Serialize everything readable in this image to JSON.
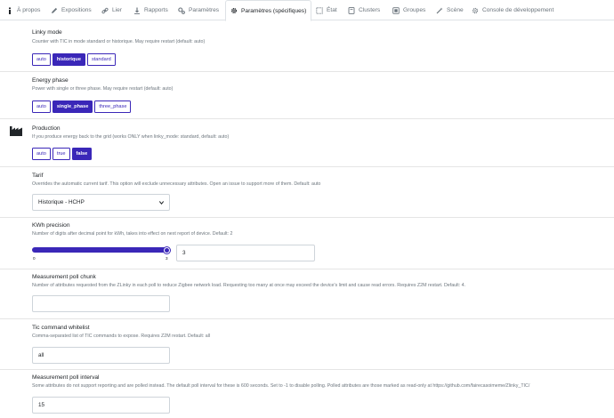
{
  "tabs": [
    {
      "label": "À propos",
      "icon": "info-icon",
      "active": false
    },
    {
      "label": "Expositions",
      "icon": "pencil-icon",
      "active": false
    },
    {
      "label": "Lier",
      "icon": "link-icon",
      "active": false
    },
    {
      "label": "Rapports",
      "icon": "download-icon",
      "active": false
    },
    {
      "label": "Paramètres",
      "icon": "gears-icon",
      "active": false
    },
    {
      "label": "Paramètres (spécifiques)",
      "icon": "gear-icon",
      "active": true
    },
    {
      "label": "État",
      "icon": "state-icon",
      "active": false
    },
    {
      "label": "Clusters",
      "icon": "clusters-icon",
      "active": false
    },
    {
      "label": "Groupes",
      "icon": "groups-icon",
      "active": false
    },
    {
      "label": "Scène",
      "icon": "wand-icon",
      "active": false
    },
    {
      "label": "Console de développement",
      "icon": "settings-icon",
      "active": false
    }
  ],
  "settings": {
    "linky_mode": {
      "title": "Linky mode",
      "description": "Counter with TIC in mode standard or historique. May require restart (default: auto)",
      "options": [
        "auto",
        "historique",
        "standard"
      ],
      "selected": "historique"
    },
    "energy_phase": {
      "title": "Energy phase",
      "description": "Power with single or three phase. May require restart (default: auto)",
      "options": [
        "auto",
        "single_phase",
        "three_phase"
      ],
      "selected": "single_phase"
    },
    "production": {
      "title": "Production",
      "description": "If you produce energy back to the grid (works ONLY when linky_mode: standard, default: auto)",
      "options": [
        "auto",
        "true",
        "false"
      ],
      "selected": "false"
    },
    "tarif": {
      "title": "Tarif",
      "description": "Overrides the automatic current tarif. This option will exclude unnecessary attributes. Open an issue to support more of them. Default: auto",
      "value": "Historique - HCHP"
    },
    "kwh_precision": {
      "title": "KWh precision",
      "description": "Number of digits after decimal point for kWh, takes into effect on next report of device. Default: 2",
      "min": "0",
      "max": "3",
      "value_fraction": 1.0,
      "value": "3"
    },
    "measurement_poll_chunk": {
      "title": "Measurement poll chunk",
      "description": "Number of attributes requested from the ZLinky in each poll to reduce Zigbee network load. Requesting too many at once may exceed the device's limit and cause read errors. Requires Z2M restart. Default: 4.",
      "value": ""
    },
    "tic_command_whitelist": {
      "title": "Tic command whitelist",
      "description": "Comma-separated list of TIC commands to expose. Requires Z2M restart. Default: all",
      "value": "all"
    },
    "measurement_poll_interval": {
      "title": "Measurement poll interval",
      "description": "Some attributes do not support reporting and are polled instead. The default poll interval for these is 600 seconds. Set to -1 to disable polling. Polled attributes are those marked as read-only at https://github.com/fairecasoimeme/Zlinky_TIC/",
      "value": "15"
    }
  },
  "colors": {
    "accent": "#3a27b8",
    "divider": "#e5e5e5",
    "muted_text": "#6c757d"
  }
}
